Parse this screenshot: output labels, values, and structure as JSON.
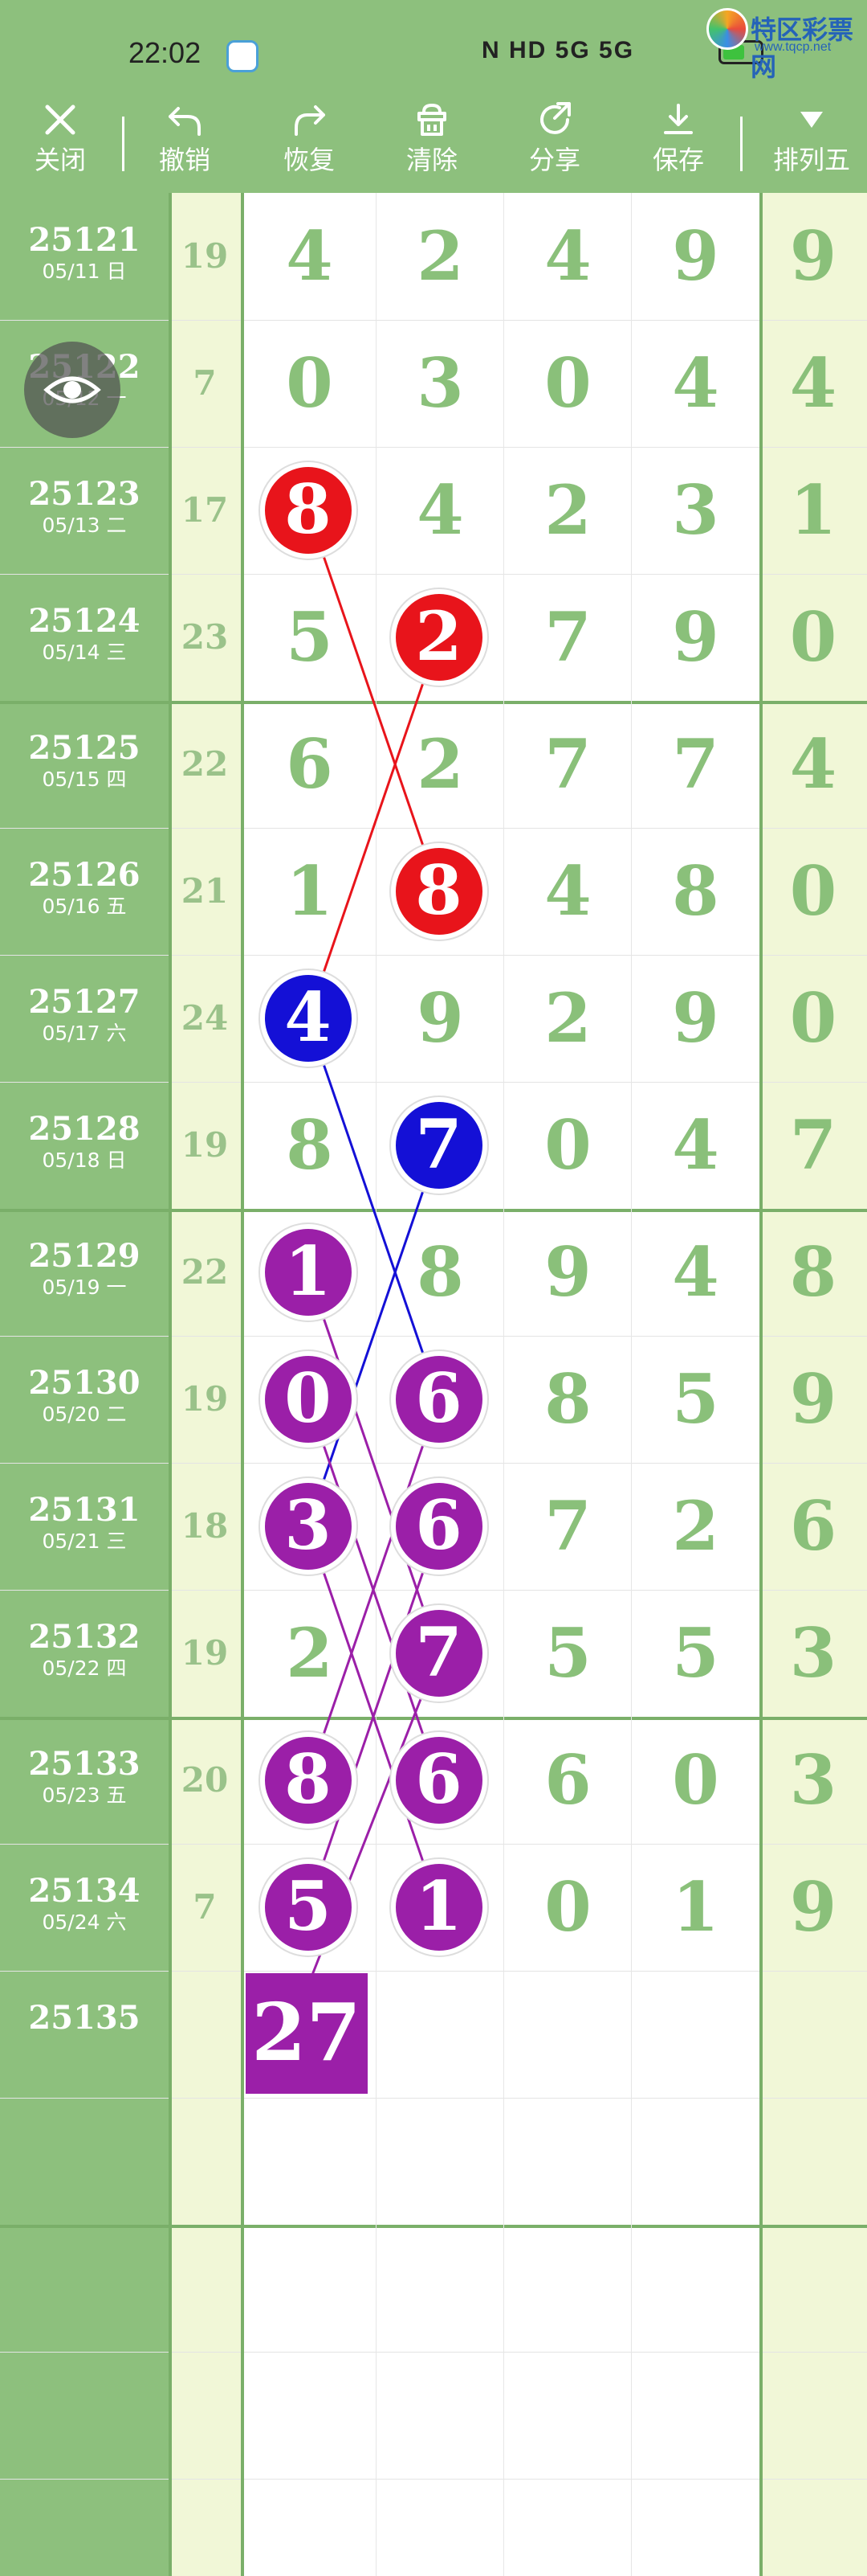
{
  "status_bar": {
    "time": "22:02",
    "indicators": "N HD 5G 5G",
    "watermark_name": "特区彩票网",
    "watermark_url": "www.tqcp.net"
  },
  "toolbar": {
    "items": [
      {
        "label": "关闭",
        "icon": "close-icon"
      },
      {
        "label": "撤销",
        "icon": "undo-icon"
      },
      {
        "label": "恢复",
        "icon": "redo-icon"
      },
      {
        "label": "清除",
        "icon": "clear-icon"
      },
      {
        "label": "分享",
        "icon": "share-icon"
      },
      {
        "label": "保存",
        "icon": "save-icon"
      },
      {
        "label": "排列五",
        "icon": "dropdown-triangle-icon"
      }
    ]
  },
  "rows": [
    {
      "issue": "25121",
      "date": "05/11 日",
      "sum": "19",
      "digits": [
        "4",
        "2",
        "4",
        "9"
      ],
      "last": "9"
    },
    {
      "issue": "25122",
      "date": "05/12 一",
      "sum": "7",
      "digits": [
        "0",
        "3",
        "0",
        "4"
      ],
      "last": "4"
    },
    {
      "issue": "25123",
      "date": "05/13 二",
      "sum": "17",
      "digits": [
        "8",
        "4",
        "2",
        "3"
      ],
      "last": "1"
    },
    {
      "issue": "25124",
      "date": "05/14 三",
      "sum": "23",
      "digits": [
        "5",
        "2",
        "7",
        "9"
      ],
      "last": "0"
    },
    {
      "issue": "25125",
      "date": "05/15 四",
      "sum": "22",
      "digits": [
        "6",
        "2",
        "7",
        "7"
      ],
      "last": "4"
    },
    {
      "issue": "25126",
      "date": "05/16 五",
      "sum": "21",
      "digits": [
        "1",
        "8",
        "4",
        "8"
      ],
      "last": "0"
    },
    {
      "issue": "25127",
      "date": "05/17 六",
      "sum": "24",
      "digits": [
        "4",
        "9",
        "2",
        "9"
      ],
      "last": "0"
    },
    {
      "issue": "25128",
      "date": "05/18 日",
      "sum": "19",
      "digits": [
        "8",
        "7",
        "0",
        "4"
      ],
      "last": "7"
    },
    {
      "issue": "25129",
      "date": "05/19 一",
      "sum": "22",
      "digits": [
        "1",
        "8",
        "9",
        "4"
      ],
      "last": "8"
    },
    {
      "issue": "25130",
      "date": "05/20 二",
      "sum": "19",
      "digits": [
        "0",
        "6",
        "8",
        "5"
      ],
      "last": "9"
    },
    {
      "issue": "25131",
      "date": "05/21 三",
      "sum": "18",
      "digits": [
        "3",
        "6",
        "7",
        "2"
      ],
      "last": "6"
    },
    {
      "issue": "25132",
      "date": "05/22 四",
      "sum": "19",
      "digits": [
        "2",
        "7",
        "5",
        "5"
      ],
      "last": "3"
    },
    {
      "issue": "25133",
      "date": "05/23 五",
      "sum": "20",
      "digits": [
        "8",
        "6",
        "6",
        "0"
      ],
      "last": "3"
    },
    {
      "issue": "25134",
      "date": "05/24 六",
      "sum": "7",
      "digits": [
        "5",
        "1",
        "0",
        "1"
      ],
      "last": "9"
    },
    {
      "issue": "25135",
      "date": "",
      "sum": "",
      "digits": [
        "",
        "",
        "",
        ""
      ],
      "last": ""
    }
  ],
  "highlights": [
    {
      "row": 2,
      "col": 0,
      "value": "8",
      "color": "red"
    },
    {
      "row": 3,
      "col": 1,
      "value": "2",
      "color": "red"
    },
    {
      "row": 5,
      "col": 1,
      "value": "8",
      "color": "red"
    },
    {
      "row": 6,
      "col": 0,
      "value": "4",
      "color": "blue"
    },
    {
      "row": 7,
      "col": 1,
      "value": "7",
      "color": "blue"
    },
    {
      "row": 8,
      "col": 0,
      "value": "1",
      "color": "purple"
    },
    {
      "row": 9,
      "col": 0,
      "value": "0",
      "color": "purple"
    },
    {
      "row": 9,
      "col": 1,
      "value": "6",
      "color": "purple"
    },
    {
      "row": 10,
      "col": 0,
      "value": "3",
      "color": "purple"
    },
    {
      "row": 10,
      "col": 1,
      "value": "6",
      "color": "purple"
    },
    {
      "row": 11,
      "col": 1,
      "value": "7",
      "color": "purple"
    },
    {
      "row": 12,
      "col": 0,
      "value": "8",
      "color": "purple"
    },
    {
      "row": 12,
      "col": 1,
      "value": "6",
      "color": "purple"
    },
    {
      "row": 13,
      "col": 0,
      "value": "5",
      "color": "purple"
    },
    {
      "row": 13,
      "col": 1,
      "value": "1",
      "color": "purple"
    }
  ],
  "connections": [
    {
      "from": [
        2,
        0
      ],
      "to": [
        5,
        1
      ],
      "color": "red"
    },
    {
      "from": [
        3,
        1
      ],
      "to": [
        6,
        0
      ],
      "color": "red"
    },
    {
      "from": [
        6,
        0
      ],
      "to": [
        9,
        1
      ],
      "color": "blue"
    },
    {
      "from": [
        7,
        1
      ],
      "to": [
        10,
        0
      ],
      "color": "blue"
    },
    {
      "from": [
        8,
        0
      ],
      "to": [
        11,
        1
      ],
      "color": "purple"
    },
    {
      "from": [
        9,
        0
      ],
      "to": [
        12,
        1
      ],
      "color": "purple"
    },
    {
      "from": [
        9,
        1
      ],
      "to": [
        12,
        0
      ],
      "color": "purple"
    },
    {
      "from": [
        10,
        0
      ],
      "to": [
        13,
        1
      ],
      "color": "purple"
    },
    {
      "from": [
        10,
        1
      ],
      "to": [
        13,
        0
      ],
      "color": "purple"
    },
    {
      "from": [
        11,
        1
      ],
      "to": [
        14,
        0
      ],
      "color": "purple"
    }
  ],
  "sum_box": {
    "row": 14,
    "col": 0,
    "value": "27"
  },
  "colors": {
    "header_green": "#8dc07d",
    "sum_column_bg": "#f1f7d7",
    "digit_text": "#8ac07a",
    "red": "#e8141b",
    "blue": "#1410d6",
    "purple": "#9b1fa8"
  },
  "overlay": {
    "eye_icon": "eye-icon"
  }
}
